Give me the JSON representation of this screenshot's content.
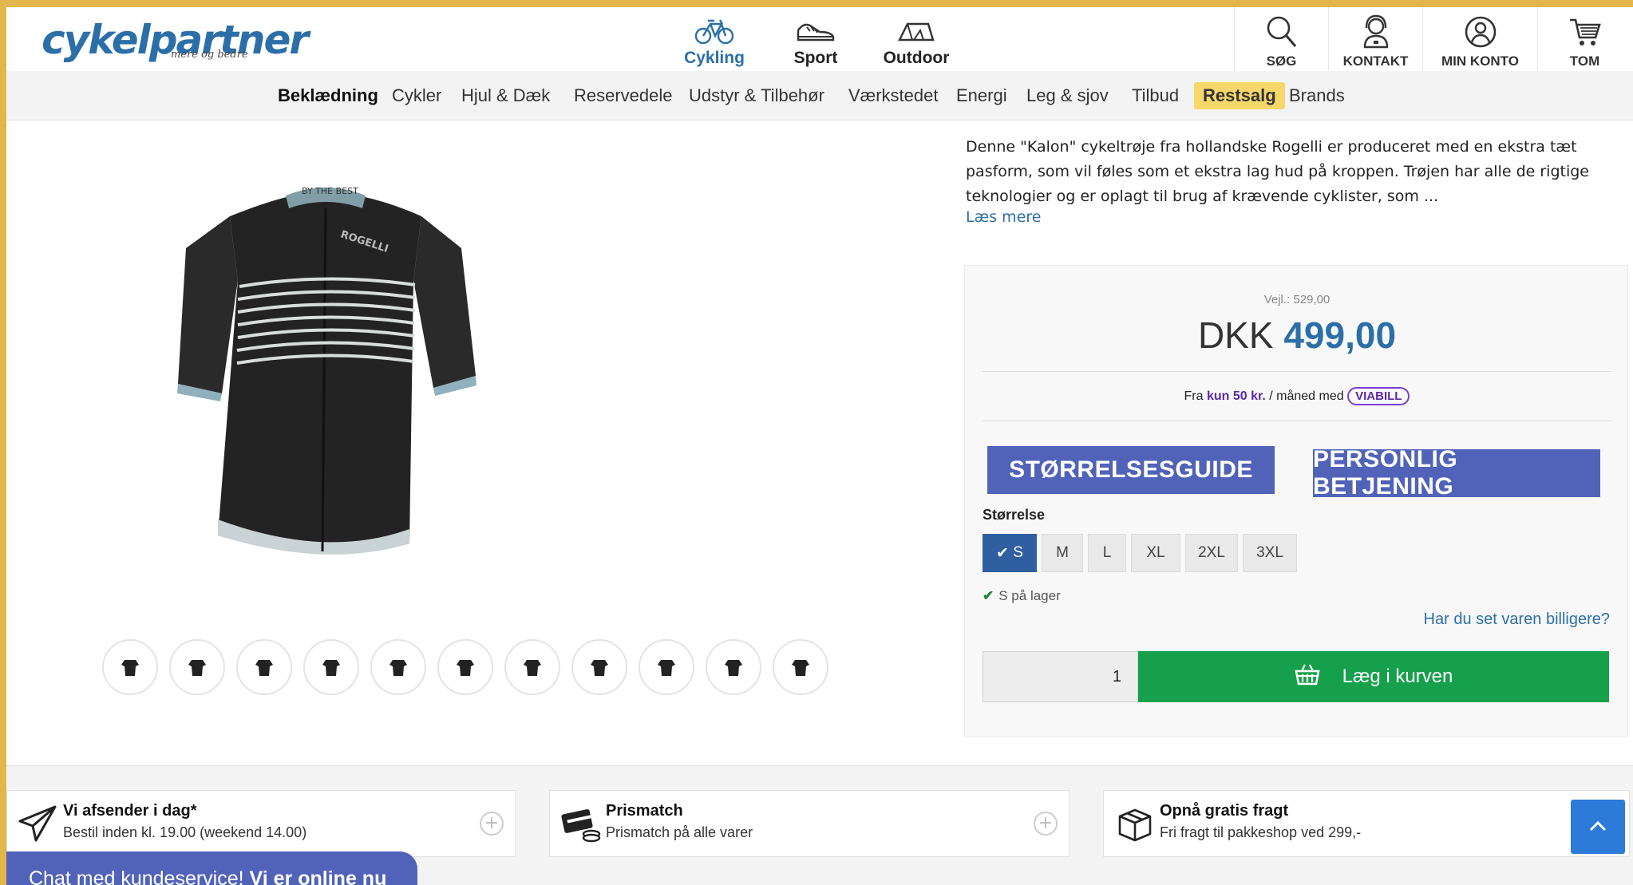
{
  "header": {
    "logo_text": "cykelpartner",
    "tagline": "mere og bedre",
    "categories": [
      {
        "label": "Cykling",
        "icon": "bicycle-icon",
        "active": true
      },
      {
        "label": "Sport",
        "icon": "shoe-icon",
        "active": false
      },
      {
        "label": "Outdoor",
        "icon": "tent-icon",
        "active": false
      }
    ],
    "utilities": [
      {
        "label": "SØG",
        "icon": "search-icon"
      },
      {
        "label": "KONTAKT",
        "icon": "headset-icon"
      },
      {
        "label": "MIN KONTO",
        "icon": "user-icon"
      },
      {
        "label": "TOM",
        "icon": "cart-icon"
      }
    ]
  },
  "nav": {
    "items": [
      "Beklædning",
      "Cykler",
      "Hjul & Dæk",
      "Reservedele",
      "Udstyr & Tilbehør",
      "Værkstedet",
      "Energi",
      "Leg & sjov",
      "Tilbud",
      "Restsalg",
      "Brands"
    ]
  },
  "product": {
    "description": "Denne \"Kalon\" cykeltrøje fra hollandske Rogelli er produceret med en ekstra tæt pasform, som vil føles som et ekstra lag hud på kroppen. Trøjen har alle de rigtige teknologier og er oplagt til brug af krævende cyklister, som ...",
    "read_more": "Læs mere",
    "jersey_brand": "ROGELLI",
    "collar_text": "BY THE BEST",
    "thumbnail_count": 11
  },
  "buybox": {
    "rrp": "Vejl.: 529,00",
    "currency": "DKK",
    "price": "499,00",
    "finance_prefix": "Fra",
    "finance_amount": "kun 50 kr.",
    "finance_suffix": "/ måned med",
    "finance_brand": "VIABILL",
    "size_guide_button": "STØRRELSESGUIDE",
    "personal_service_button": "PERSONLIG BETJENING",
    "size_label": "Størrelse",
    "sizes": [
      "S",
      "M",
      "L",
      "XL",
      "2XL",
      "3XL"
    ],
    "selected_size": "S",
    "stock_text": "S på lager",
    "cheaper_link": "Har du set varen billigere?",
    "quantity": "1",
    "add_to_cart": "Læg i kurven"
  },
  "usps": [
    {
      "title": "Vi afsender i dag*",
      "subtitle": "Bestil inden kl. 19.00 (weekend 14.00)",
      "icon": "paper-plane-icon"
    },
    {
      "title": "Prismatch",
      "subtitle": "Prismatch på alle varer",
      "icon": "card-coins-icon"
    },
    {
      "title": "Opnå gratis fragt",
      "subtitle": "Fri fragt til pakkeshop ved 299,-",
      "icon": "package-icon"
    }
  ],
  "chat": {
    "prefix": "Chat med kundeservice!",
    "highlight": "Vi er online nu"
  },
  "colors": {
    "brand_blue": "#2c6fa8",
    "button_purple": "#5163b8",
    "cart_green": "#16a04b",
    "sale_yellow": "#f6d76a",
    "frame_gold": "#e1b64a"
  }
}
